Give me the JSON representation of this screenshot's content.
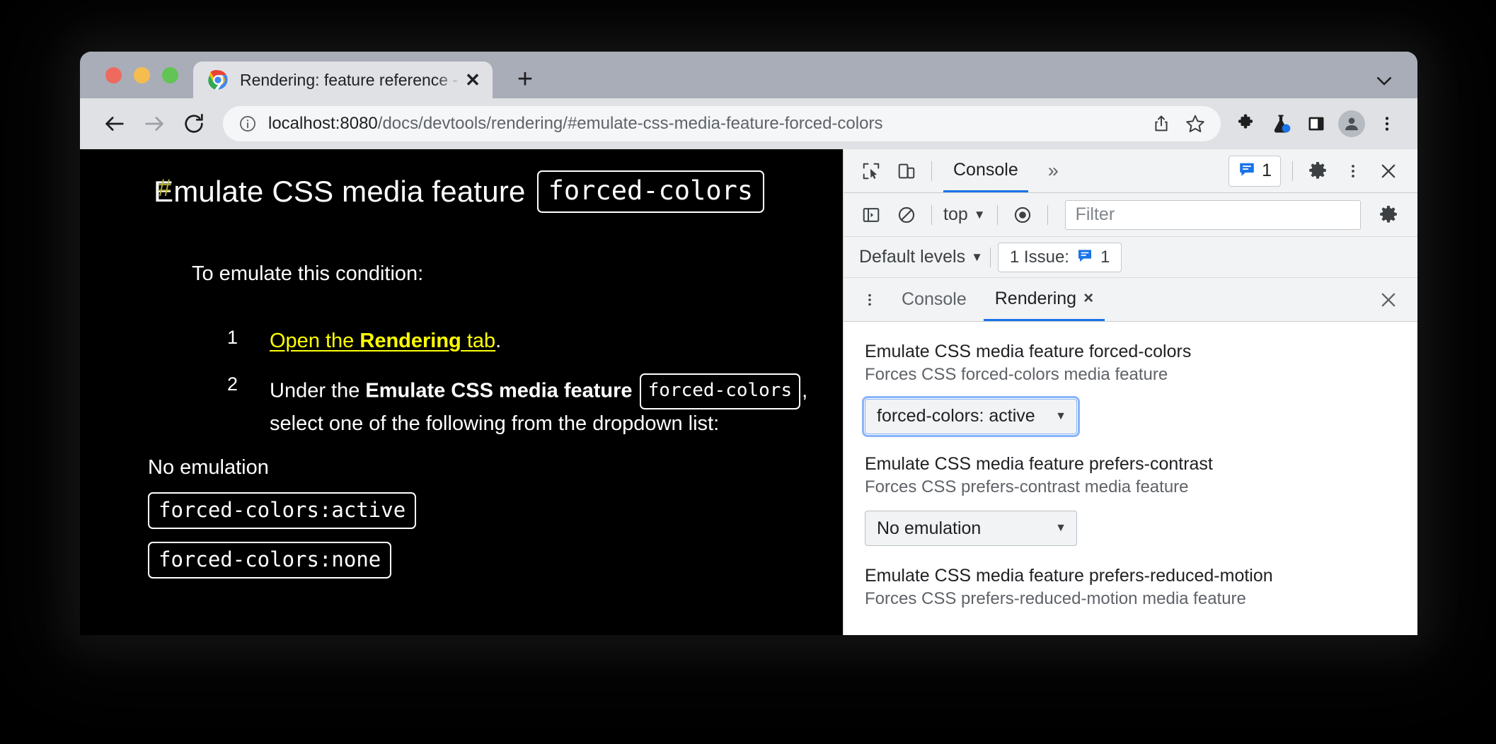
{
  "browser": {
    "tab": {
      "title": "Rendering: feature reference -",
      "favicon_icon": "chrome-favicon",
      "close_icon": "close-icon"
    },
    "new_tab_icon": "plus-icon",
    "tabstrip_chevron_icon": "chevron-down-icon",
    "toolbar": {
      "back_icon": "arrow-left-icon",
      "forward_icon": "arrow-right-icon",
      "reload_icon": "reload-icon",
      "info_icon": "info-circle-icon",
      "url_host": "localhost:8080",
      "url_path": "/docs/devtools/rendering/#emulate-css-media-feature-forced-colors",
      "share_icon": "share-icon",
      "bookmark_icon": "star-icon",
      "extensions_icon": "puzzle-piece-icon",
      "labs_icon": "flask-icon",
      "side_panel_icon": "side-panel-icon",
      "profile_icon": "avatar-icon",
      "menu_icon": "kebab-menu-icon"
    }
  },
  "page": {
    "anchor_symbol": "#",
    "title": "Emulate CSS media feature",
    "title_code": "forced-colors",
    "intro": "To emulate this condition:",
    "steps": [
      {
        "num": "1",
        "link_prefix": "Open the ",
        "link_bold": "Rendering",
        "link_suffix": " tab",
        "trailing": "."
      },
      {
        "num": "2",
        "prefix": "Under the ",
        "bold": "Emulate CSS media feature",
        "code": "forced-colors",
        "comma": ",",
        "line2": "select one of the following from the dropdown list:"
      }
    ],
    "options": {
      "plain": "No emulation",
      "code_active": "forced-colors:active",
      "code_none": "forced-colors:none"
    }
  },
  "devtools": {
    "toolbar": {
      "inspect_icon": "inspect-cursor-icon",
      "device_toggle_icon": "device-toolbar-icon",
      "active_tab": "Console",
      "overflow_label": "»",
      "issues_icon": "issue-message-icon",
      "issues_count": "1",
      "settings_icon": "gear-icon",
      "more_icon": "kebab-menu-icon",
      "close_icon": "close-icon"
    },
    "console_filter": {
      "sidebar_icon": "console-sidebar-icon",
      "clear_icon": "clear-console-icon",
      "context": "top",
      "context_caret": "▼",
      "eye_icon": "live-expression-icon",
      "filter_placeholder": "Filter",
      "settings_icon": "gear-icon"
    },
    "levels_bar": {
      "levels_label": "Default levels",
      "levels_caret": "▼",
      "issue_label": "1 Issue:",
      "issue_icon": "issue-message-icon",
      "issue_count": "1"
    },
    "drawer": {
      "kebab_icon": "kebab-menu-icon",
      "tab_console": "Console",
      "tab_rendering": "Rendering",
      "tab_rendering_close": "×",
      "close_icon": "close-icon"
    },
    "rendering": {
      "groups": [
        {
          "title": "Emulate CSS media feature forced-colors",
          "desc": "Forces CSS forced-colors media feature",
          "value": "forced-colors: active",
          "caret": "▼",
          "focused": true
        },
        {
          "title": "Emulate CSS media feature prefers-contrast",
          "desc": "Forces CSS prefers-contrast media feature",
          "value": "No emulation",
          "caret": "▼",
          "focused": false
        },
        {
          "title": "Emulate CSS media feature prefers-reduced-motion",
          "desc": "Forces CSS prefers-reduced-motion media feature",
          "value": "",
          "caret": "",
          "focused": false
        }
      ]
    }
  },
  "colors": {
    "accent_blue": "#1a73e8",
    "focus_ring": "#8ab4f8",
    "link_yellow": "#ffff00",
    "anchor_yellow": "#b9b43a",
    "window_chrome": "#a9adb8",
    "toolbar_bg": "#dfe1e5",
    "devtools_bg": "#f1f3f4"
  }
}
